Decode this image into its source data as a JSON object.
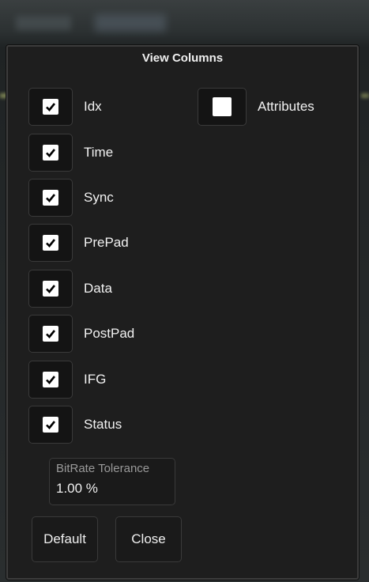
{
  "dialog": {
    "title": "View Columns",
    "columns": [
      {
        "label": "Idx",
        "checked": true
      },
      {
        "label": "Time",
        "checked": true
      },
      {
        "label": "Sync",
        "checked": true
      },
      {
        "label": "PrePad",
        "checked": true
      },
      {
        "label": "Data",
        "checked": true
      },
      {
        "label": "PostPad",
        "checked": true
      },
      {
        "label": "IFG",
        "checked": true
      },
      {
        "label": "Status",
        "checked": true
      }
    ],
    "attributes": {
      "label": "Attributes",
      "checked": false
    },
    "bitrate": {
      "label": "BitRate Tolerance",
      "value": "1.00 %"
    },
    "default_label": "Default",
    "close_label": "Close"
  },
  "colors": {
    "dialog_bg": "#1e1e1e",
    "checkbox_bg": "#141414",
    "check": "#000000",
    "text": "#f2f2f2"
  },
  "icons": {
    "checked": "checkmark-icon",
    "unchecked": "empty-checkbox-icon"
  }
}
